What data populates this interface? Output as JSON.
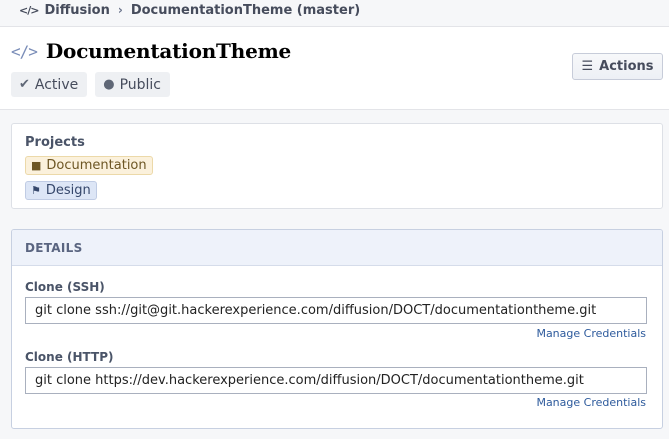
{
  "breadcrumb": {
    "icon": "code-icon",
    "app": "Diffusion",
    "repo": "DocumentationTheme (master)"
  },
  "header": {
    "icon": "code-icon",
    "title": "DocumentationTheme",
    "tags": [
      {
        "icon": "check-icon",
        "label": "Active"
      },
      {
        "icon": "globe-icon",
        "label": "Public"
      }
    ],
    "actions_label": "Actions"
  },
  "projects": {
    "label": "Projects",
    "items": [
      {
        "icon": "briefcase-icon",
        "label": "Documentation",
        "color": "#fbf1dc"
      },
      {
        "icon": "flag-icon",
        "label": "Design",
        "color": "#dde6f6"
      }
    ]
  },
  "details": {
    "heading": "DETAILS",
    "ssh": {
      "label": "Clone (SSH)",
      "value": "git clone ssh://git@git.hackerexperience.com/diffusion/DOCT/documentationtheme.git",
      "manage": "Manage Credentials"
    },
    "http": {
      "label": "Clone (HTTP)",
      "value": "git clone https://dev.hackerexperience.com/diffusion/DOCT/documentationtheme.git",
      "manage": "Manage Credentials"
    }
  }
}
